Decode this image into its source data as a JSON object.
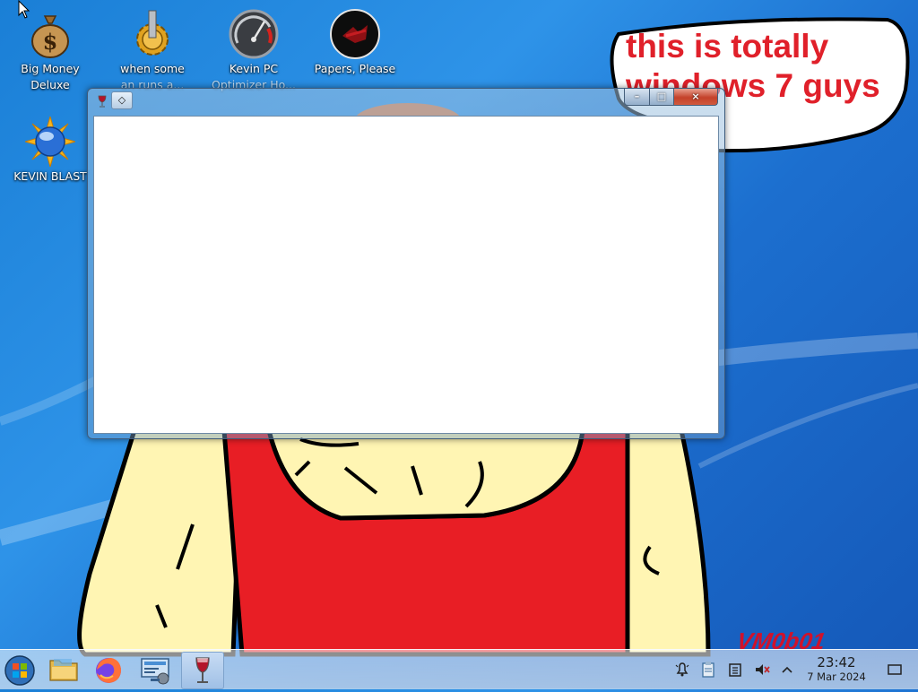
{
  "desktop": {
    "icons": [
      {
        "label": "Big Money",
        "label2": "Deluxe",
        "icon": "money-bag-icon"
      },
      {
        "label": "when some",
        "label2": "an runs a...",
        "icon": "gear-icon"
      },
      {
        "label": "Kevin PC",
        "label2": "Optimizer Ho...",
        "icon": "speedometer-icon"
      },
      {
        "label": "Papers, Please",
        "label2": "",
        "icon": "papers-please-icon"
      },
      {
        "label": "KEVIN BLAST",
        "label2": "",
        "icon": "globe-sun-icon"
      }
    ],
    "speech_bubble_text": [
      "this is totally",
      "windows 7 guys"
    ],
    "signature": "VM0b01"
  },
  "window": {
    "title": "",
    "buttons": {
      "minimize": "–",
      "maximize": "□",
      "close": "×"
    }
  },
  "taskbar": {
    "items": [
      "start-orb",
      "file-explorer",
      "firefox",
      "control-panel",
      "wine-app"
    ],
    "active_item": "wine-app",
    "tray_icons": [
      "notifications-bell-icon",
      "clipboard-icon",
      "network-icon",
      "muted-speaker-icon",
      "show-hidden-icon"
    ],
    "clock": {
      "time": "23:42",
      "date": "7 Mar 2024"
    }
  },
  "colors": {
    "desktop_blue": "#1a7fd6",
    "bubble_text": "#e0202a",
    "shirt_red": "#e81e25",
    "skin": "#fff5b3"
  }
}
